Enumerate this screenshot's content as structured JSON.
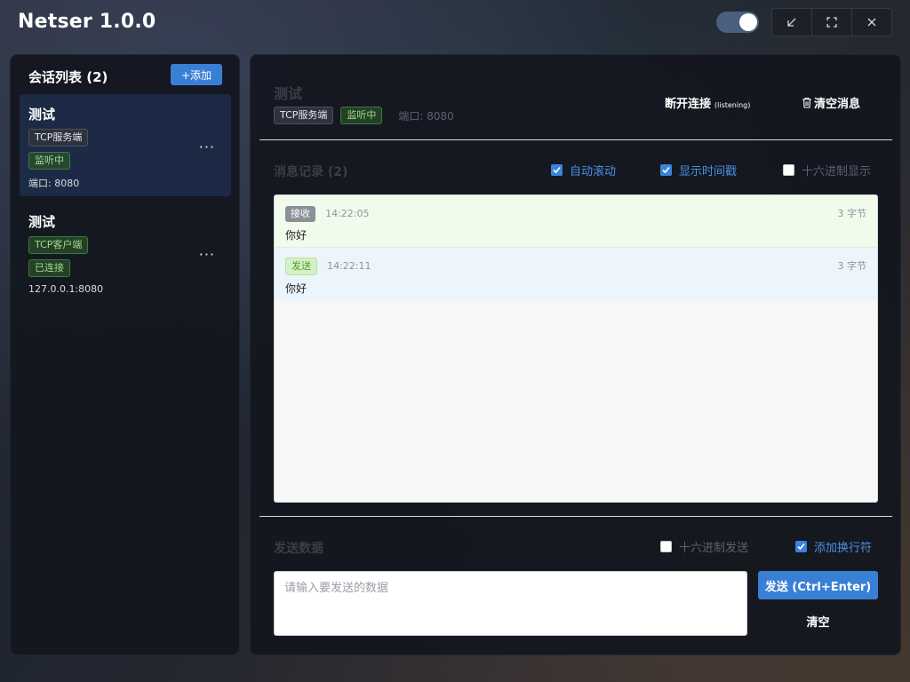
{
  "app": {
    "title": "Netser 1.0.0"
  },
  "window_controls": {
    "toggle_state": "on"
  },
  "sidebar": {
    "header_title": "会话列表",
    "count": "(2)",
    "add_label": "+添加",
    "sessions": [
      {
        "title": "测试",
        "type": "TCP服务端",
        "status": "监听中",
        "info": "端口: 8080",
        "more": "···"
      },
      {
        "title": "测试",
        "type": "TCP客户端",
        "status": "已连接",
        "info": "127.0.0.1:8080",
        "more": "···"
      }
    ]
  },
  "main": {
    "title": "测试",
    "type_tag": "TCP服务端",
    "status_tag": "监听中",
    "port_label": "端口: 8080",
    "disconnect_label": "断开连接",
    "disconnect_sub": "(listening)",
    "clear_messages_label": "清空消息",
    "log_title": "消息记录",
    "log_count": "(2)",
    "auto_scroll_label": "自动滚动",
    "show_timestamp_label": "显示时间戳",
    "hex_display_label": "十六进制显示",
    "messages": [
      {
        "direction": "接收",
        "time": "14:22:05",
        "size": "3 字节",
        "content": "你好"
      },
      {
        "direction": "发送",
        "time": "14:22:11",
        "size": "3 字节",
        "content": "你好"
      }
    ],
    "send_title": "发送数据",
    "hex_send_label": "十六进制发送",
    "append_newline_label": "添加换行符",
    "input_placeholder": "请输入要发送的数据",
    "input_value": "",
    "send_button_label": "发送 (Ctrl+Enter)",
    "clear_button_label": "清空"
  },
  "colors": {
    "accent": "#3a7fd6",
    "status_green": "#9fdc8a",
    "recv_row": "#f1fbec",
    "sent_row": "#ecf4fc"
  }
}
